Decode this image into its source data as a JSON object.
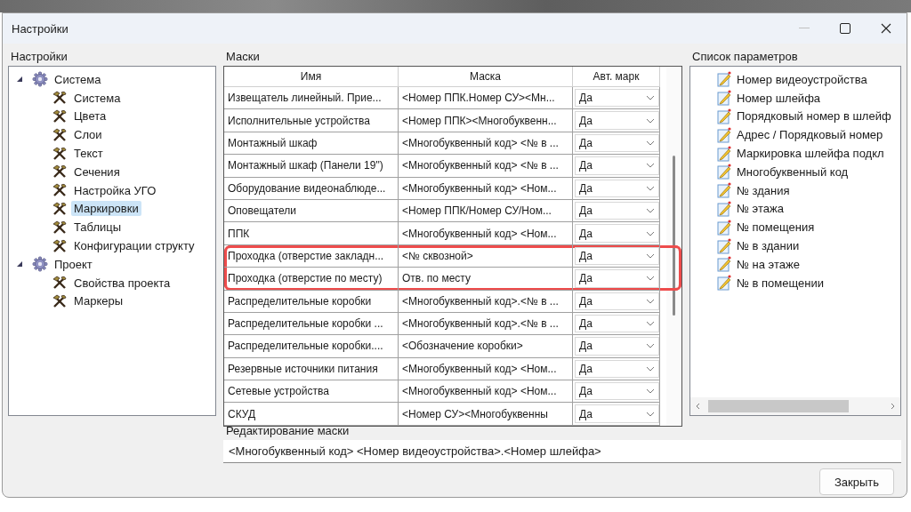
{
  "window": {
    "title": "Настройки"
  },
  "settings_tree": {
    "title": "Настройки",
    "items": [
      {
        "label": "Система",
        "kind": "group",
        "expanded": true,
        "selected": false,
        "children": [
          {
            "label": "Система",
            "kind": "page",
            "selected": false
          },
          {
            "label": "Цвета",
            "kind": "page",
            "selected": false
          },
          {
            "label": "Слои",
            "kind": "page",
            "selected": false
          },
          {
            "label": "Текст",
            "kind": "page",
            "selected": false
          },
          {
            "label": "Сечения",
            "kind": "page",
            "selected": false
          },
          {
            "label": "Настройка УГО",
            "kind": "page",
            "selected": false
          },
          {
            "label": "Маркировки",
            "kind": "page",
            "selected": true
          },
          {
            "label": "Таблицы",
            "kind": "page",
            "selected": false
          },
          {
            "label": "Конфигурации структу",
            "kind": "page",
            "selected": false
          }
        ]
      },
      {
        "label": "Проект",
        "kind": "group",
        "expanded": true,
        "selected": false,
        "children": [
          {
            "label": "Свойства проекта",
            "kind": "page",
            "selected": false
          },
          {
            "label": "Маркеры",
            "kind": "page",
            "selected": false
          }
        ]
      }
    ]
  },
  "masks": {
    "title": "Маски",
    "columns": [
      "Имя",
      "Маска",
      "Авт. марк"
    ],
    "rows": [
      {
        "name": "Извещатель линейный. Прие...",
        "mask": "<Номер ППК.Номер СУ><Мн...",
        "auto": "Да",
        "highlighted": false
      },
      {
        "name": "Исполнительные устройства",
        "mask": "<Номер ППК><Многобуквенн...",
        "auto": "Да",
        "highlighted": false
      },
      {
        "name": "Монтажный шкаф",
        "mask": "<Многобуквенный код> <№ в ...",
        "auto": "Да",
        "highlighted": false
      },
      {
        "name": "Монтажный шкаф (Панели 19\")",
        "mask": "<Многобуквенный код> <№ в ...",
        "auto": "Да",
        "highlighted": false
      },
      {
        "name": "Оборудование видеонаблюде...",
        "mask": "<Многобуквенный код> <Ном...",
        "auto": "Да",
        "highlighted": false
      },
      {
        "name": "Оповещатели",
        "mask": "<Номер ППК/Номер СУ/Ном...",
        "auto": "Да",
        "highlighted": false
      },
      {
        "name": "ППК",
        "mask": "<Многобуквенный код> <Ном...",
        "auto": "Да",
        "highlighted": false
      },
      {
        "name": "Проходка (отверстие закладн...",
        "mask": "<№ сквозной>",
        "auto": "Да",
        "highlighted": true
      },
      {
        "name": "Проходка (отверстие по месту)",
        "mask": "Отв. по месту",
        "auto": "Да",
        "highlighted": true
      },
      {
        "name": "Распределительные коробки",
        "mask": "<Многобуквенный код>.<№ в ...",
        "auto": "Да",
        "highlighted": false
      },
      {
        "name": "Распределительные коробки ...",
        "mask": "<Многобуквенный код>.<№ в ...",
        "auto": "Да",
        "highlighted": false
      },
      {
        "name": "Распределительные коробки....",
        "mask": "<Обозначение коробки>",
        "auto": "Да",
        "highlighted": false
      },
      {
        "name": "Резервные источники питания",
        "mask": "<Многобуквенный код> <Ном...",
        "auto": "Да",
        "highlighted": false
      },
      {
        "name": "Сетевые устройства",
        "mask": "<Многобуквенный код> <Ном...",
        "auto": "Да",
        "highlighted": false
      },
      {
        "name": "СКУД",
        "mask": "<Номер СУ><Многобуквенны",
        "auto": "Да",
        "highlighted": false
      }
    ]
  },
  "parameters": {
    "title": "Список параметров",
    "items": [
      "Номер видеоустройства",
      "Номер шлейфа",
      "Порядковый номер в шлейф",
      "Адрес / Порядковый номер",
      "Маркировка шлейфа подкл",
      "Многобуквенный код",
      "№ здания",
      "№ этажа",
      "№ помещения",
      "№ в здании",
      "№ на этаже",
      "№ в помещении"
    ]
  },
  "mask_editor": {
    "title": "Редактирование маски",
    "value": "<Многобуквенный код> <Номер видеоустройства>.<Номер шлейфа>"
  },
  "close_button": {
    "label": "Закрыть"
  }
}
